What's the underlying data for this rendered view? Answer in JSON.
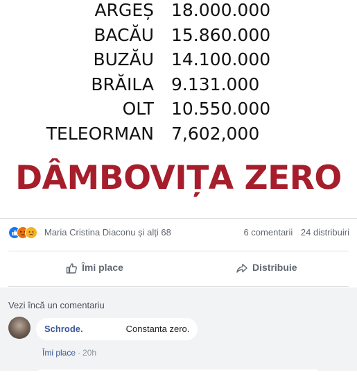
{
  "post_image": {
    "rows": [
      {
        "county": "ARGEȘ",
        "amount": "18.000.000"
      },
      {
        "county": "BACĂU",
        "amount": "15.860.000"
      },
      {
        "county": "BUZĂU",
        "amount": "14.100.000"
      },
      {
        "county": "BRĂILA",
        "amount": "9.131.000"
      },
      {
        "county": "OLT",
        "amount": "10.550.000"
      },
      {
        "county": "TELEORMAN",
        "amount": "7,602,000"
      }
    ],
    "headline": "DÂMBOVIȚA ZERO",
    "headline_color": "#a61e2b"
  },
  "reactions": {
    "icons": [
      "like-icon",
      "angry-icon",
      "sad-icon"
    ],
    "reactors": "Maria Cristina Diaconu și alți 68",
    "comments_count": "6 comentarii",
    "shares_count": "24 distribuiri"
  },
  "actions": {
    "like_label": "Îmi place",
    "share_label": "Distribuie"
  },
  "comments": {
    "view_more": "Vezi încă un comentariu",
    "items": [
      {
        "author": "Schrode.",
        "text": "Constanta zero.",
        "like_label": "Îmi place",
        "separator": "·",
        "time": "20h"
      }
    ]
  },
  "colors": {
    "link": "#385898",
    "like_blue": "#1877f2",
    "muted": "#616770"
  }
}
